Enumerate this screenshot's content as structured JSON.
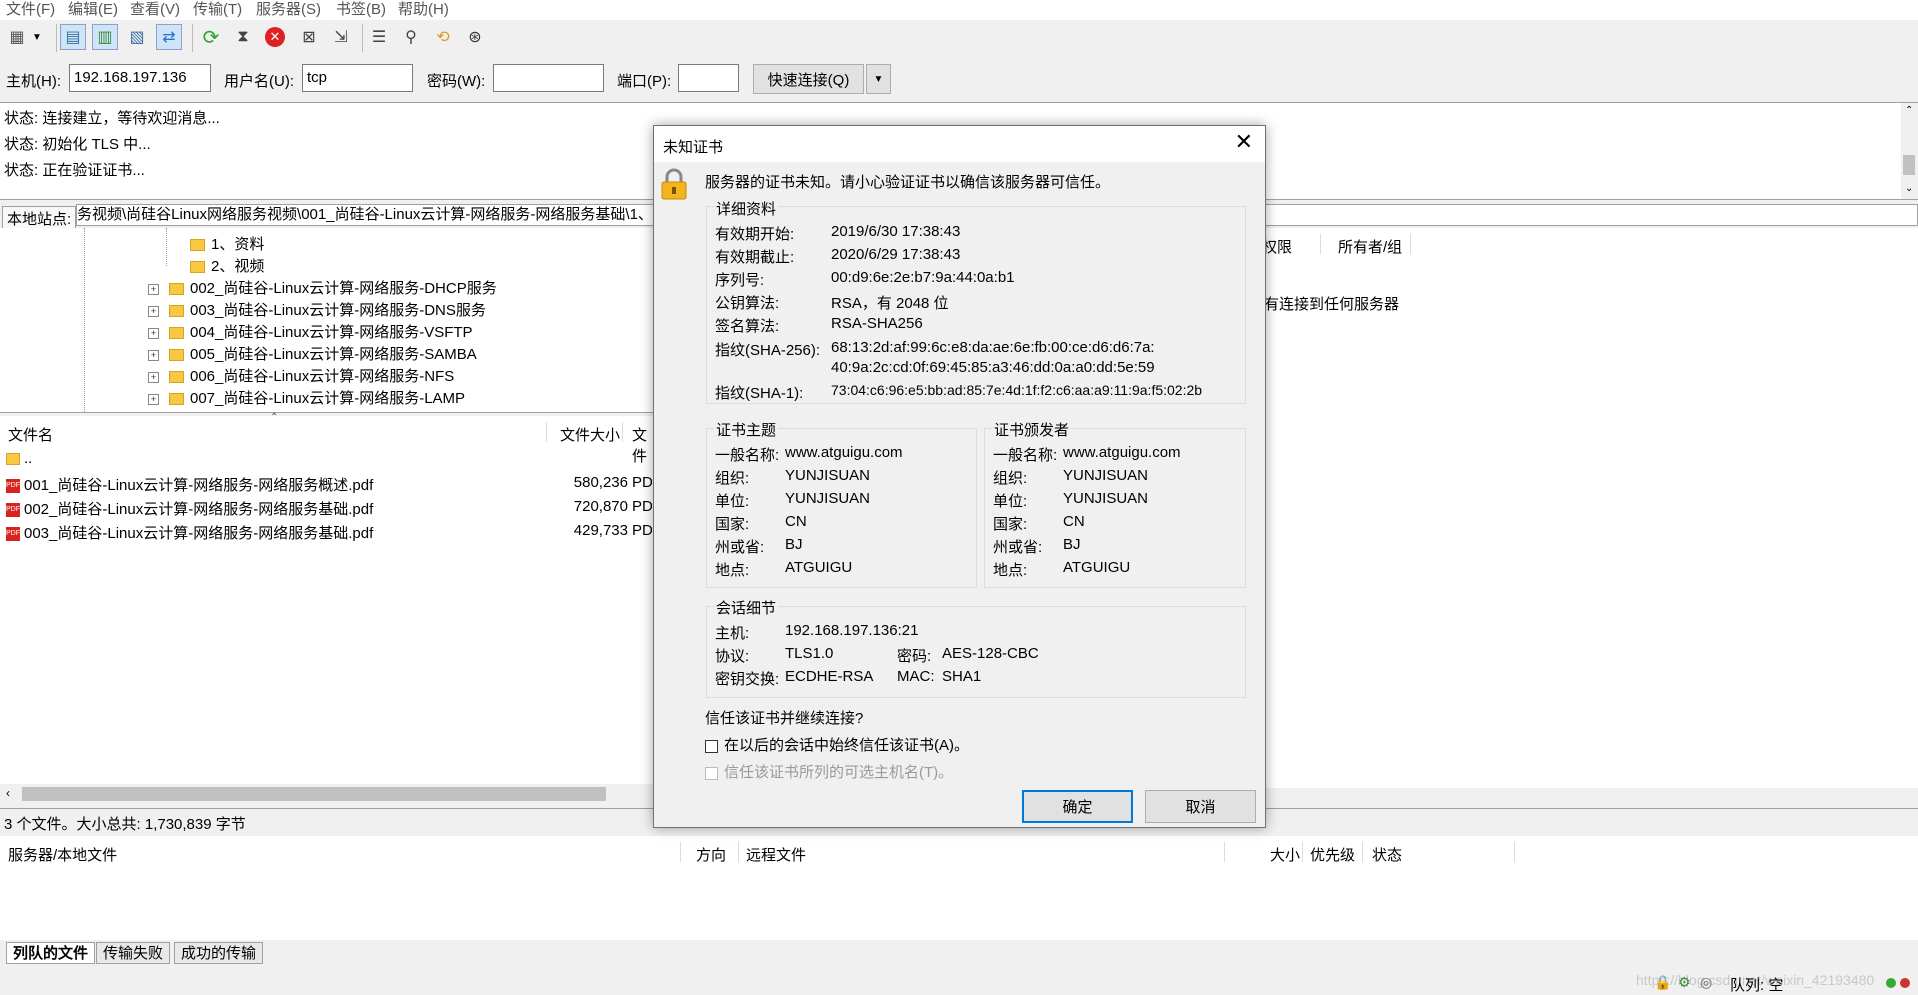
{
  "menu": [
    "文件(F)",
    "编辑(E)",
    "查看(V)",
    "传输(T)",
    "服务器(S)",
    "书签(B)",
    "帮助(H)"
  ],
  "quickconnect": {
    "host_label": "主机(H):",
    "host_value": "192.168.197.136",
    "user_label": "用户名(U):",
    "user_value": "tcp",
    "pass_label": "密码(W):",
    "pass_value": "",
    "port_label": "端口(P):",
    "port_value": "",
    "connect_button": "快速连接(Q)"
  },
  "log": [
    "状态: 连接建立，等待欢迎消息...",
    "状态: 初始化 TLS 中...",
    "状态: 正在验证证书..."
  ],
  "local": {
    "site_label": "本地站点:",
    "site_path": "务视频\\尚硅谷Linux网络服务视频\\001_尚硅谷-Linux云计算-网络服务-网络服务基础\\1、",
    "tree": [
      "1、资料",
      "2、视频",
      "002_尚硅谷-Linux云计算-网络服务-DHCP服务",
      "003_尚硅谷-Linux云计算-网络服务-DNS服务",
      "004_尚硅谷-Linux云计算-网络服务-VSFTP",
      "005_尚硅谷-Linux云计算-网络服务-SAMBA",
      "006_尚硅谷-Linux云计算-网络服务-NFS",
      "007_尚硅谷-Linux云计算-网络服务-LAMP"
    ],
    "headers": {
      "name": "文件名",
      "size": "文件大小",
      "type": "文件"
    },
    "files": [
      {
        "name": "..",
        "size": "",
        "type": ""
      },
      {
        "name": "001_尚硅谷-Linux云计算-网络服务-网络服务概述.pdf",
        "size": "580,236",
        "type": "PD"
      },
      {
        "name": "002_尚硅谷-Linux云计算-网络服务-网络服务基础.pdf",
        "size": "720,870",
        "type": "PD"
      },
      {
        "name": "003_尚硅谷-Linux云计算-网络服务-网络服务基础.pdf",
        "size": "429,733",
        "type": "PD"
      }
    ],
    "summary": "3 个文件。大小总共: 1,730,839 字节"
  },
  "remote": {
    "col_perm": "权限",
    "col_owner": "所有者/组",
    "empty_text": "有连接到任何服务器"
  },
  "queue": {
    "headers": {
      "server": "服务器/本地文件",
      "direction": "方向",
      "remote": "远程文件",
      "size": "大小",
      "priority": "优先级",
      "status": "状态"
    },
    "tabs": [
      "列队的文件",
      "传输失败",
      "成功的传输"
    ]
  },
  "statusbar": {
    "queue": "队列: 空",
    "watermark": "https://blog.csdn.net/weixin_42193480"
  },
  "dialog": {
    "title": "未知证书",
    "intro": "服务器的证书未知。请小心验证证书以确信该服务器可信任。",
    "details_title": "详细资料",
    "details": [
      {
        "k": "有效期开始:",
        "v": "2019/6/30 17:38:43"
      },
      {
        "k": "有效期截止:",
        "v": "2020/6/29 17:38:43"
      },
      {
        "k": "序列号:",
        "v": "00:d9:6e:2e:b7:9a:44:0a:b1"
      },
      {
        "k": "公钥算法:",
        "v": "RSA，有 2048 位"
      },
      {
        "k": "签名算法:",
        "v": "RSA-SHA256"
      }
    ],
    "sha256_label": "指纹(SHA-256):",
    "sha256_line1": "68:13:2d:af:99:6c:e8:da:ae:6e:fb:00:ce:d6:d6:7a:",
    "sha256_line2": "40:9a:2c:cd:0f:69:45:85:a3:46:dd:0a:a0:dd:5e:59",
    "sha1_label": "指纹(SHA-1):",
    "sha1_value": "73:04:c6:96:e5:bb:ad:85:7e:4d:1f:f2:c6:aa:a9:11:9a:f5:02:2b",
    "subject_title": "证书主题",
    "issuer_title": "证书颁发者",
    "subject": [
      {
        "k": "一般名称:",
        "v": "www.atguigu.com"
      },
      {
        "k": "组织:",
        "v": "YUNJISUAN"
      },
      {
        "k": "单位:",
        "v": "YUNJISUAN"
      },
      {
        "k": "国家:",
        "v": "CN"
      },
      {
        "k": "州或省:",
        "v": "BJ"
      },
      {
        "k": "地点:",
        "v": "ATGUIGU"
      }
    ],
    "issuer": [
      {
        "k": "一般名称:",
        "v": "www.atguigu.com"
      },
      {
        "k": "组织:",
        "v": "YUNJISUAN"
      },
      {
        "k": "单位:",
        "v": "YUNJISUAN"
      },
      {
        "k": "国家:",
        "v": "CN"
      },
      {
        "k": "州或省:",
        "v": "BJ"
      },
      {
        "k": "地点:",
        "v": "ATGUIGU"
      }
    ],
    "session_title": "会话细节",
    "session": {
      "host_k": "主机:",
      "host_v": "192.168.197.136:21",
      "proto_k": "协议:",
      "proto_v": "TLS1.0",
      "cipher_k": "密码:",
      "cipher_v": "AES-128-CBC",
      "kex_k": "密钥交换:",
      "kex_v": "ECDHE-RSA",
      "mac_k": "MAC:",
      "mac_v": "SHA1"
    },
    "question": "信任该证书并继续连接?",
    "always_trust": "在以后的会话中始终信任该证书(A)。",
    "trust_alt": "信任该证书所列的可选主机名(T)。",
    "ok": "确定",
    "cancel": "取消"
  }
}
